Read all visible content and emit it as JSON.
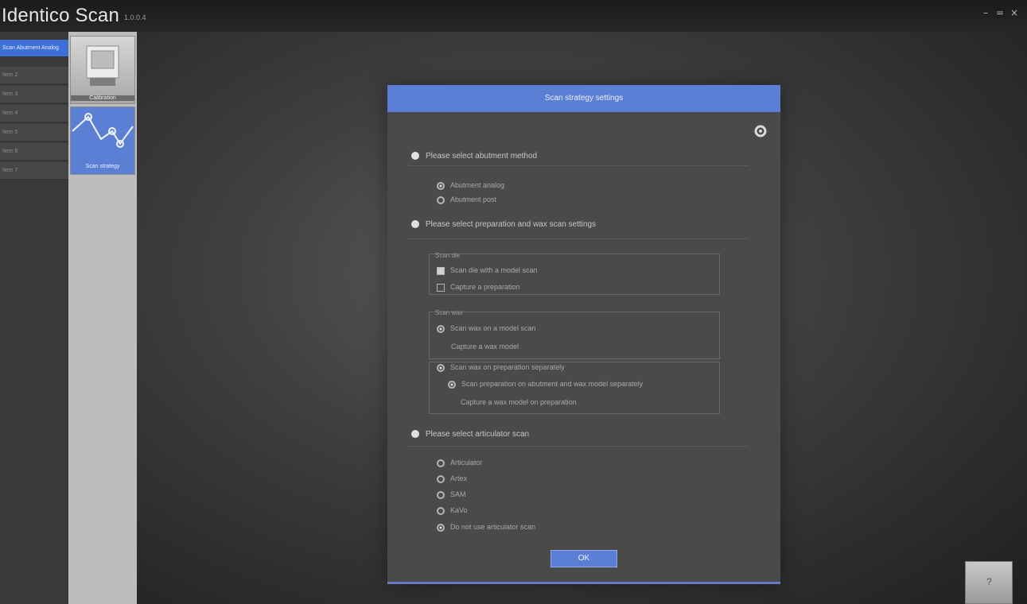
{
  "app": {
    "title": "Identico Scan",
    "version": "1.0.0.4",
    "window_controls": [
      "–",
      "=",
      "×"
    ]
  },
  "nav": {
    "items": [
      "Scan Abutment Analog",
      "Item 2",
      "Item 3",
      "Item 4",
      "Item 5",
      "Item 6",
      "Item 7"
    ]
  },
  "tools": [
    {
      "label": "Calibration"
    },
    {
      "label": "Scan strategy"
    }
  ],
  "dialog": {
    "title": "Scan strategy settings",
    "section1": {
      "label": "Please select abutment method",
      "options": [
        "Abutment analog",
        "Abutment post"
      ]
    },
    "section2": {
      "label": "Please select preparation and wax scan settings",
      "group1": {
        "title": "Scan die",
        "options": [
          "Scan die with a model scan",
          "Capture a preparation"
        ]
      },
      "group2": {
        "title": "Scan wax",
        "options": [
          "Scan wax on a model scan",
          "Capture a wax model"
        ]
      },
      "group3": {
        "options": [
          "Scan wax on preparation separately",
          "Scan preparation on abutment and wax model separately",
          "Capture a wax model on preparation"
        ]
      }
    },
    "section3": {
      "label": "Please select articulator scan",
      "options": [
        "Articulator",
        "Artex",
        "SAM",
        "KaVo",
        "Do not use articulator scan"
      ]
    },
    "ok_label": "OK"
  },
  "corner_button": {
    "icon": "?"
  },
  "colors": {
    "accent": "#5b7fd4",
    "nav_active": "#3d6fd4",
    "dialog_bg": "#4a4a4a"
  }
}
